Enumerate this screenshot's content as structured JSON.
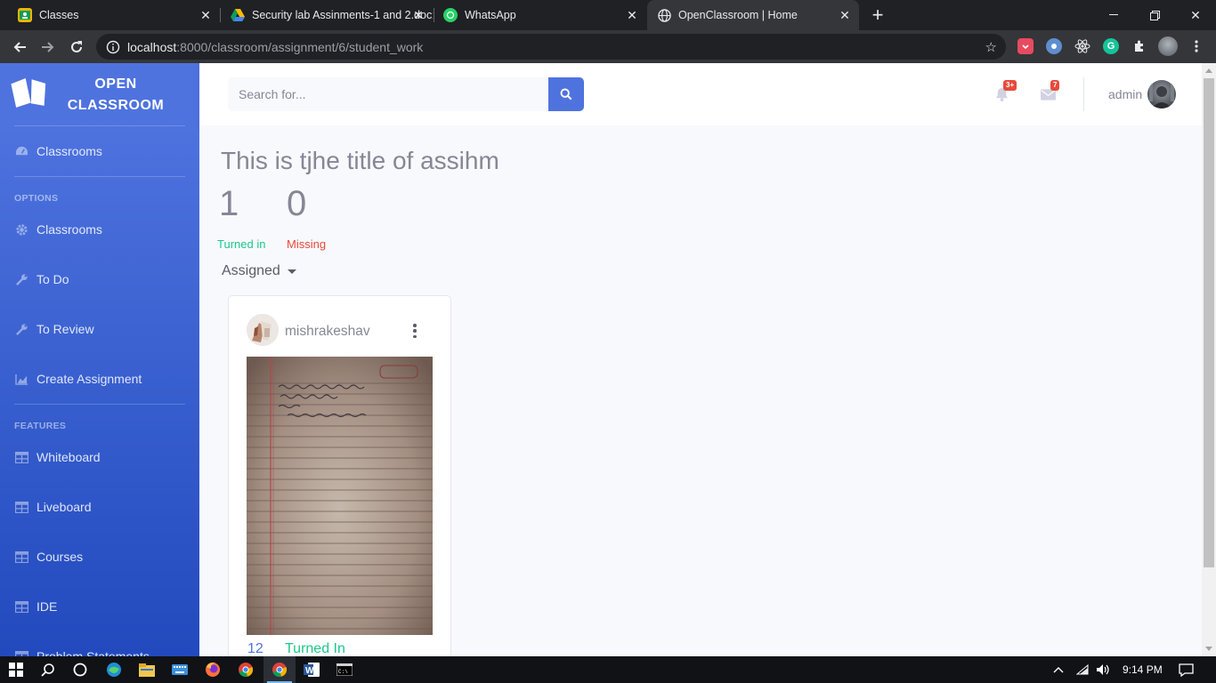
{
  "browser": {
    "tabs": [
      {
        "title": "Classes",
        "icon": "google-classroom-icon",
        "active": false
      },
      {
        "title": "Security lab Assinments-1 and 2.docx",
        "icon": "google-drive-icon",
        "active": false
      },
      {
        "title": "WhatsApp",
        "icon": "whatsapp-icon",
        "active": false
      },
      {
        "title": "OpenClassroom | Home",
        "icon": "globe-icon",
        "active": true
      }
    ],
    "url_host": "localhost",
    "url_path": ":8000/classroom/assignment/6/student_work"
  },
  "sidebar": {
    "brand": "OPEN CLASSROOM",
    "top_item": "Classrooms",
    "heading_options": "OPTIONS",
    "options": [
      "Classrooms",
      "To Do",
      "To Review",
      "Create Assignment"
    ],
    "heading_features": "FEATURES",
    "features": [
      "Whiteboard",
      "Liveboard",
      "Courses",
      "IDE",
      "Problem Statements"
    ]
  },
  "topbar": {
    "search_placeholder": "Search for...",
    "alerts_badge": "3+",
    "messages_badge": "7",
    "username": "admin"
  },
  "assignment": {
    "title": "This is tjhe title of assihm",
    "turned_in_count": "1",
    "turned_in_label": "Turned in",
    "missing_count": "0",
    "missing_label": "Missing",
    "filter_label": "Assigned"
  },
  "submission": {
    "username": "mishrakeshav",
    "count": "12",
    "status": "Turned In"
  },
  "taskbar": {
    "time": "9:14 PM"
  },
  "colors": {
    "primary": "#4e73df",
    "success": "#1cc88a",
    "danger": "#e74a3b",
    "text_muted": "#858796"
  }
}
